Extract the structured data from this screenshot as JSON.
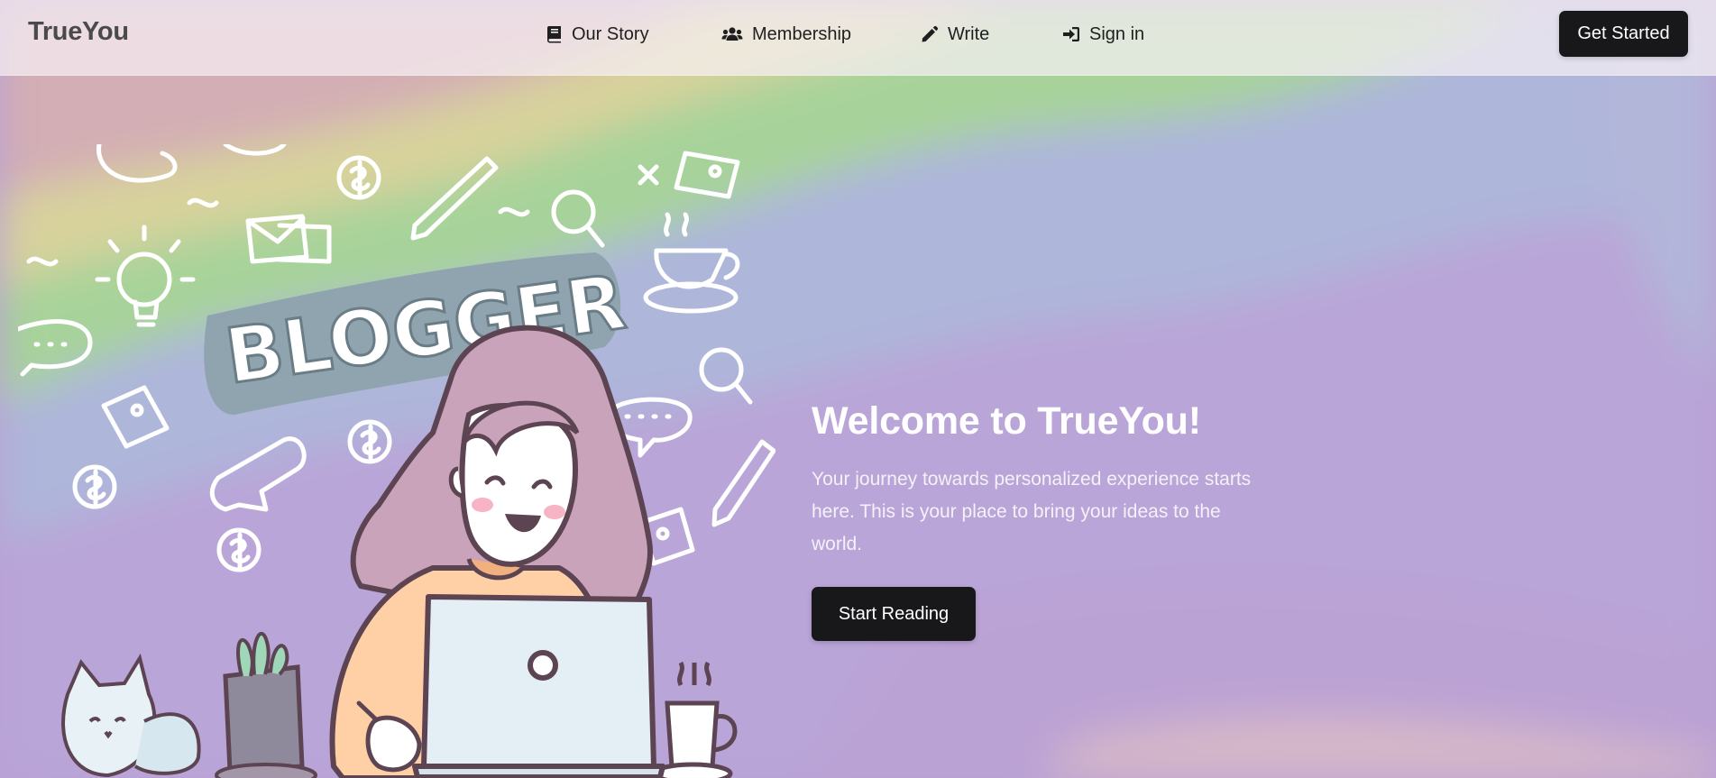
{
  "brand": {
    "name": "TrueYou"
  },
  "nav": {
    "items": [
      {
        "label": "Our Story",
        "icon": "book-icon"
      },
      {
        "label": "Membership",
        "icon": "users-icon"
      },
      {
        "label": "Write",
        "icon": "pencil-icon"
      },
      {
        "label": "Sign in",
        "icon": "sign-in-icon"
      }
    ],
    "cta_label": "Get Started"
  },
  "hero": {
    "title": "Welcome to TrueYou!",
    "description": "Your journey towards personalized experience starts here. This is your place to bring your ideas to the world.",
    "button_label": "Start Reading",
    "illustration_text": "BLOGGER"
  },
  "colors": {
    "button_bg": "#18181b",
    "button_text": "#ffffff",
    "bg_pink": "#d4aeb6",
    "bg_yellow": "#d9d39c",
    "bg_green": "#a6d49a",
    "bg_blue": "#aeb6da",
    "bg_purple": "#b9a1d5"
  }
}
